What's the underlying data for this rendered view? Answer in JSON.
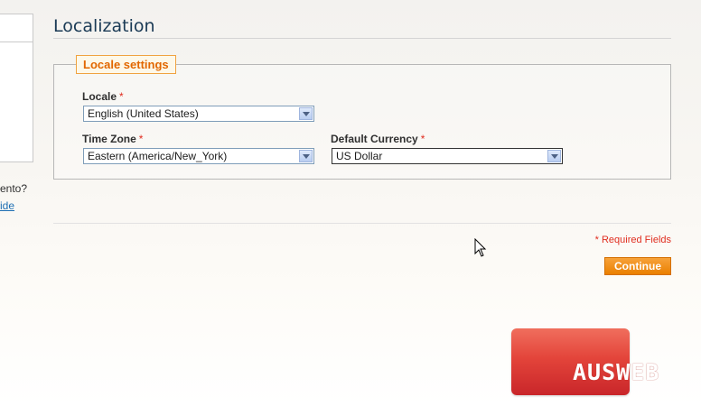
{
  "sidebar": {
    "question_text": "ento?",
    "link_text": "ide"
  },
  "page": {
    "title": "Localization"
  },
  "locale_settings": {
    "legend": "Locale settings",
    "locale": {
      "label": "Locale",
      "required_mark": "*",
      "value": "English (United States)"
    },
    "timezone": {
      "label": "Time Zone",
      "required_mark": "*",
      "value": "Eastern (America/New_York)"
    },
    "currency": {
      "label": "Default Currency",
      "required_mark": "*",
      "value": "US Dollar"
    }
  },
  "footer": {
    "required_note": "* Required Fields",
    "continue_label": "Continue"
  },
  "watermark": {
    "text": "AUSWEB"
  },
  "colors": {
    "accent_orange": "#ea7f00",
    "legend_text": "#e26700",
    "required_red": "#e02d1f",
    "title_blue": "#1a3a55",
    "logo_red": "#e3443a"
  }
}
